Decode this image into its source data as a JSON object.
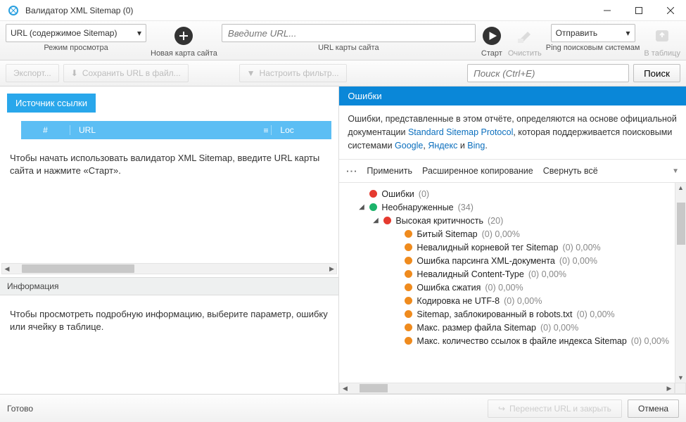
{
  "window": {
    "title": "Валидатор XML Sitemap (0)"
  },
  "toolbar": {
    "mode": {
      "value": "URL (содержимое Sitemap)",
      "label": "Режим просмотра"
    },
    "newmap": {
      "label": "Новая карта сайта"
    },
    "urlinput": {
      "placeholder": "Введите URL...",
      "label": "URL карты сайта"
    },
    "start": {
      "label": "Старт"
    },
    "clear": {
      "label": "Очистить"
    },
    "send": {
      "value": "Отправить",
      "label": "Ping поисковым системам"
    },
    "totable": {
      "label": "В таблицу"
    }
  },
  "toolbar2": {
    "export": "Экспорт...",
    "save": "Сохранить URL в файл...",
    "filter": "Настроить фильтр...",
    "search_placeholder": "Поиск (Ctrl+E)",
    "search_btn": "Поиск"
  },
  "left": {
    "tab": "Источник ссылки",
    "cols": {
      "c1": "#",
      "c2": "URL",
      "c3": "Loc"
    },
    "hint": "Чтобы начать использовать валидатор XML Sitemap, введите URL карты сайта и нажмите «Старт».",
    "info_header": "Информация",
    "info_body": "Чтобы просмотреть подробную информацию, выберите параметр, ошибку или ячейку в таблице."
  },
  "right": {
    "tab": "Ошибки",
    "desc_pre": "Ошибки, представленные в этом отчёте, определяются на основе официальной документации ",
    "desc_lnk1": "Standard Sitemap Protocol",
    "desc_mid": ", которая поддерживается поисковыми системами ",
    "desc_g": "Google",
    "desc_y": "Яндекс",
    "desc_and": " и ",
    "desc_b": "Bing",
    "desc_comma": ", ",
    "desc_dot": ".",
    "actions": {
      "apply": "Применить",
      "copy": "Расширенное копирование",
      "collapse": "Свернуть всё"
    },
    "tree": {
      "errors": {
        "label": "Ошибки",
        "count": "(0)"
      },
      "undetected": {
        "label": "Необнаруженные",
        "count": "(34)"
      },
      "high": {
        "label": "Высокая критичность",
        "count": "(20)"
      },
      "items": [
        {
          "label": "Битый Sitemap",
          "count": "(0) 0,00%"
        },
        {
          "label": "Невалидный корневой тег Sitemap",
          "count": "(0) 0,00%"
        },
        {
          "label": "Ошибка парсинга XML-документа",
          "count": "(0) 0,00%"
        },
        {
          "label": "Невалидный Content-Type",
          "count": "(0) 0,00%"
        },
        {
          "label": "Ошибка сжатия",
          "count": "(0) 0,00%"
        },
        {
          "label": "Кодировка не UTF-8",
          "count": "(0) 0,00%"
        },
        {
          "label": "Sitemap, заблокированный в robots.txt",
          "count": "(0) 0,00%"
        },
        {
          "label": "Макс. размер файла Sitemap",
          "count": "(0) 0,00%"
        },
        {
          "label": "Макс. количество ссылок в файле индекса Sitemap",
          "count": "(0) 0,00%"
        }
      ]
    }
  },
  "footer": {
    "status": "Готово",
    "transfer": "Перенести URL и закрыть",
    "cancel": "Отмена"
  }
}
